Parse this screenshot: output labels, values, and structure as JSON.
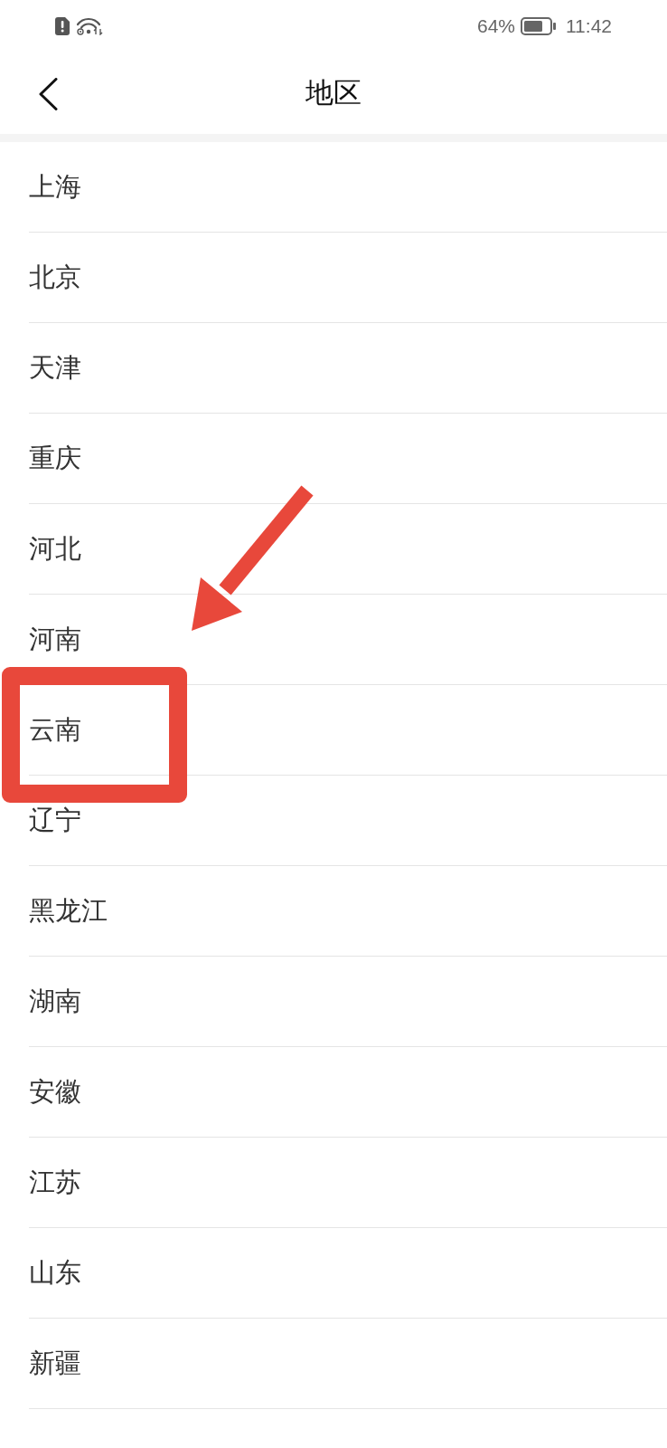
{
  "status_bar": {
    "battery": "64%",
    "time": "11:42"
  },
  "header": {
    "title": "地区"
  },
  "regions": [
    {
      "name": "上海",
      "highlighted": false
    },
    {
      "name": "北京",
      "highlighted": false
    },
    {
      "name": "天津",
      "highlighted": false
    },
    {
      "name": "重庆",
      "highlighted": false
    },
    {
      "name": "河北",
      "highlighted": false
    },
    {
      "name": "河南",
      "highlighted": false
    },
    {
      "name": "云南",
      "highlighted": true
    },
    {
      "name": "辽宁",
      "highlighted": false
    },
    {
      "name": "黑龙江",
      "highlighted": false
    },
    {
      "name": "湖南",
      "highlighted": false
    },
    {
      "name": "安徽",
      "highlighted": false
    },
    {
      "name": "江苏",
      "highlighted": false
    },
    {
      "name": "山东",
      "highlighted": false
    },
    {
      "name": "新疆",
      "highlighted": false
    }
  ]
}
